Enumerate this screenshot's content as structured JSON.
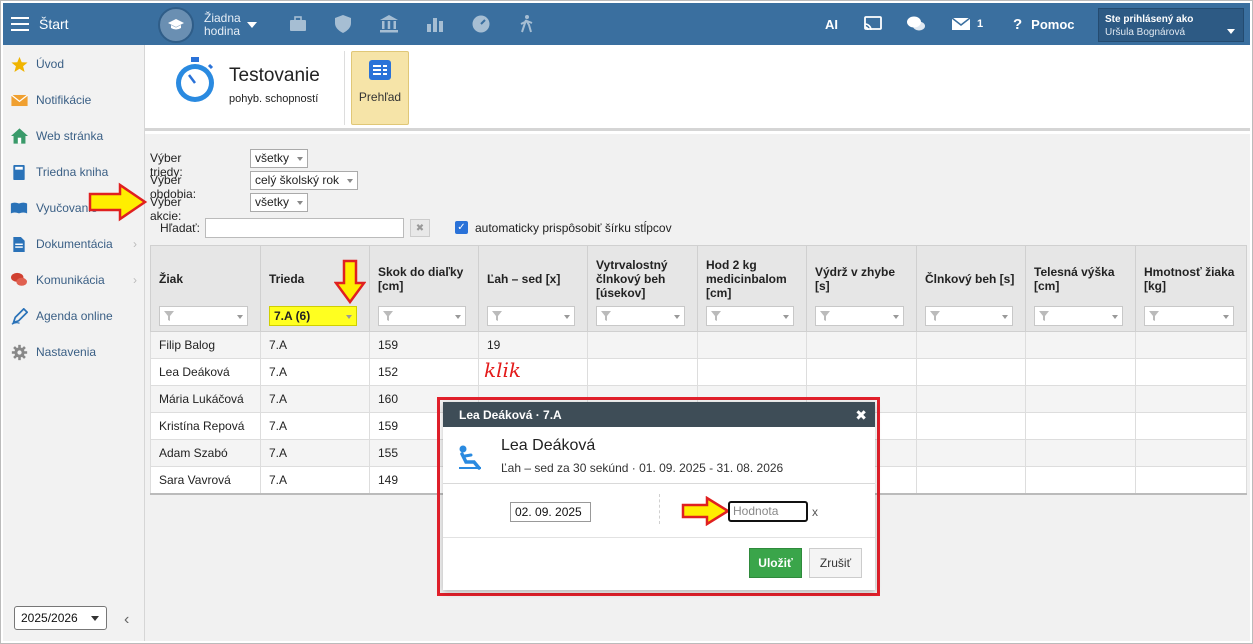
{
  "topbar": {
    "menu_label": "Štart",
    "lesson_line1": "Žiadna",
    "lesson_line2": "hodina",
    "ai_label": "AI",
    "mail_count": "1",
    "help_label": "Pomoc",
    "user_line1": "Ste prihlásený ako",
    "user_line2": "Uršula Bognárová"
  },
  "sidebar": {
    "items": [
      {
        "label": "Úvod",
        "icon": "star-icon",
        "color": "#f0b400"
      },
      {
        "label": "Notifikácie",
        "icon": "envelope-icon",
        "color": "#f0a030"
      },
      {
        "label": "Web stránka",
        "icon": "home-icon",
        "color": "#3a9a6a"
      },
      {
        "label": "Triedna kniha",
        "icon": "book-icon",
        "color": "#2a72b8"
      },
      {
        "label": "Vyučovanie",
        "icon": "open-book-icon",
        "color": "#2a72b8"
      },
      {
        "label": "Dokumentácia",
        "icon": "document-icon",
        "color": "#2a72b8"
      },
      {
        "label": "Komunikácia",
        "icon": "chat-icon",
        "color": "#d04030"
      },
      {
        "label": "Agenda online",
        "icon": "pen-icon",
        "color": "#2a72b8"
      },
      {
        "label": "Nastavenia",
        "icon": "gear-icon",
        "color": "#888888"
      }
    ],
    "year_value": "2025/2026"
  },
  "header": {
    "title": "Testovanie",
    "subtitle": "pohyb. schopností",
    "overview_label": "Prehľad"
  },
  "filters": {
    "class_label": "Výber triedy:",
    "class_value": "všetky",
    "period_label": "Výber obdobia:",
    "period_value": "celý školský rok",
    "action_label": "Výber akcie:",
    "action_value": "všetky",
    "search_label": "Hľadať:",
    "clear_label": "✖",
    "auto_width_label": "automaticky prispôsobiť šírku stĺpcov"
  },
  "table": {
    "columns": [
      "Žiak",
      "Trieda",
      "Skok do diaľky [cm]",
      "Ľah – sed [x]",
      "Vytrvalostný člnkový beh [úsekov]",
      "Hod 2 kg medicinbalom [cm]",
      "Výdrž v zhybe [s]",
      "Člnkový beh [s]",
      "Telesná výška [cm]",
      "Hmotnosť žiaka [kg]"
    ],
    "class_filter_value": "7.A (6)",
    "rows": [
      [
        "Filip Balog",
        "7.A",
        "159",
        "19"
      ],
      [
        "Lea Deáková",
        "7.A",
        "152",
        ""
      ],
      [
        "Mária Lukáčová",
        "7.A",
        "160",
        ""
      ],
      [
        "Kristína Repová",
        "7.A",
        "159",
        ""
      ],
      [
        "Adam Szabó",
        "7.A",
        "155",
        ""
      ],
      [
        "Sara Vavrová",
        "7.A",
        "149",
        ""
      ]
    ]
  },
  "annotation": {
    "click_text": "klik"
  },
  "modal": {
    "header": "Lea Deáková · 7.A",
    "close": "✖",
    "name": "Lea Deáková",
    "description": "Ľah – sed za 30 sekúnd · 01. 09. 2025 - 31. 08. 2026",
    "date_value": "02. 09. 2025",
    "value_placeholder": "Hodnota",
    "value_suffix": "x",
    "save_label": "Uložiť",
    "cancel_label": "Zrušiť"
  }
}
